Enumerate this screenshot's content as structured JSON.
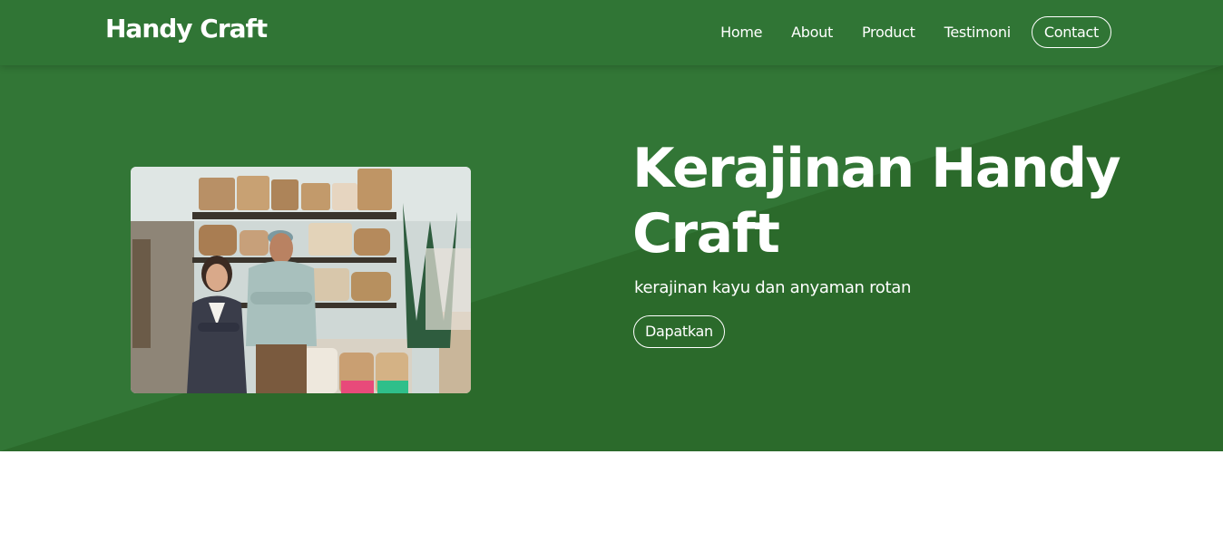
{
  "navbar": {
    "brand": "Handy Craft",
    "links": [
      "Home",
      "About",
      "Product",
      "Testimoni"
    ],
    "contact_label": "Contact"
  },
  "hero": {
    "title": "Kerajinan Handy Craft",
    "subtitle": "kerajinan kayu dan anyaman rotan",
    "cta_label": "Dapatkan"
  },
  "colors": {
    "primary_green": "#307535",
    "dark_green": "#2c6b2c",
    "text": "#ffffff"
  }
}
